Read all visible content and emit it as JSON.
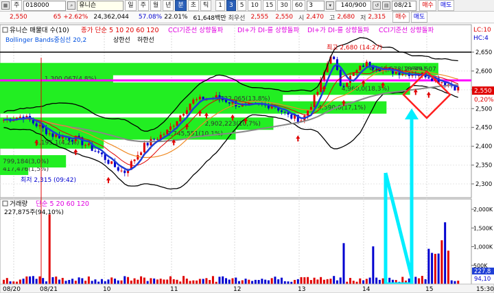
{
  "toolbar1": {
    "mode_label": "주",
    "code": "018000",
    "stock_name": "유니슨",
    "periods": [
      "일",
      "주",
      "월",
      "년",
      "분",
      "초",
      "틱"
    ],
    "active_period": "분",
    "intervals": [
      "1",
      "3",
      "5",
      "10",
      "15",
      "30",
      "60"
    ],
    "active_interval": "3",
    "interval_select": "3",
    "count": "140/900",
    "date": "08/21",
    "buy_label": "매수",
    "sell_label": "매도"
  },
  "toolbar2": {
    "price": "2,550",
    "change": "65",
    "change_pct": "+2.62%",
    "volume": "24,362,044",
    "vol_ratio": "57.08%",
    "turnover": "22.01%",
    "amount": "61,648백만",
    "priority_sell_label": "최우선",
    "priority_sell": "2,555",
    "priority_buy": "2,550",
    "open_label": "시",
    "open": "2,470",
    "high_label": "고",
    "high": "2,680",
    "low_label": "저",
    "low": "2,315"
  },
  "colors": {
    "up": "#e00000",
    "down": "#0000d0",
    "green_band": "#22ee22",
    "magenta": "#ff00ff",
    "cyan": "#00eeff",
    "ma_blue": "#1f3fd6",
    "ma_orange": "#f08a24",
    "ma_gray": "#888888"
  },
  "price_panel": {
    "legend1": "유니슨 매물대 수(10)",
    "legend2": "종가 단순 5 10 20 60 120",
    "legend3": "CCI기준선 상향돌파",
    "legend4": "DI+가 DI-를 상향돌파",
    "legend5": "DI+가 DI-를 상향돌파",
    "legend6": "CCI기준선 상향돌파",
    "legend_bb": "Bollinger Bands중심선 20,2",
    "legend_upper": "상한선",
    "legend_lower": "하한선",
    "high_marker": "최고 2,680 (14:27)",
    "low_marker": "최저 2,315 (09:42)",
    "corner_lc": "LC:10",
    "corner_hc": "HC:4",
    "price_tag": "2,550",
    "pct_tag": "0,20%",
    "axis": [
      "2,650",
      "2,600",
      "2,550",
      "2,500",
      "2,450",
      "2,400",
      "2,350",
      "2,300"
    ],
    "axis_values": [
      2650,
      2600,
      2550,
      2500,
      2450,
      2400,
      2350,
      2300
    ],
    "volume_profile": [
      {
        "label": "417,476(1,5%)",
        "price": 2340,
        "width": 0.06
      },
      {
        "label": "799,184(3,0%)",
        "price": 2360,
        "width": 0.14
      },
      {
        "label": "1,195,1(4,2%)",
        "price": 2410,
        "width": 0.22
      },
      {
        "label": "2,745,551(10,1%)",
        "price": 2434,
        "width": 0.5
      },
      {
        "label": "2,902,223(10,7%)",
        "price": 2460,
        "width": 0.58
      },
      {
        "label": "4,590,0(17,1%)",
        "price": 2503,
        "width": 0.82
      },
      {
        "label": "3,722,065(13,8%)",
        "price": 2527,
        "width": 0.6
      },
      {
        "label": "4,960,0(18,3%)",
        "price": 2553,
        "width": 0.87
      },
      {
        "label": "1,300,067(4,8%)",
        "price": 2580,
        "width": 0.24
      },
      {
        "label": "4,965,578(18,5%)",
        "price": 2605,
        "width": 0.93
      },
      {
        "label": "2,649,507",
        "price": 2605,
        "width": 0.0
      }
    ],
    "cci_price": 2575
  },
  "volume_panel": {
    "legend1": "거래량",
    "legend2": "단순 5 20 60 120",
    "value": "227,875주(94,10%)",
    "axis": [
      "2,000K",
      "1,500K",
      "1,000K",
      "500K"
    ],
    "axis_values": [
      2000,
      1500,
      1000,
      500
    ],
    "right_tag1": "227,8",
    "right_tag2": "94,10"
  },
  "time_axis": [
    "08/20",
    "08/21",
    "10",
    "11",
    "12",
    "13",
    "14",
    "15",
    "15:30"
  ]
}
